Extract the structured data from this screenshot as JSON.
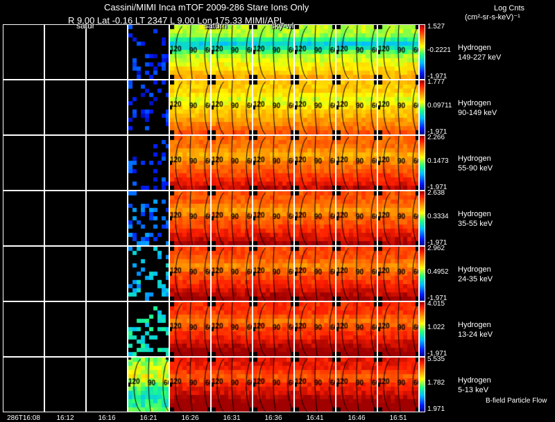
{
  "header": {
    "title": "Cassini/MIMI Inca mTOF  2009-286   Stare   Ions Only",
    "position_line": "R        9.00 Lat -0.16 LT 2347 L        9.00 Lon       175.33  MIMI/APL",
    "units_line1": "Log Cnts",
    "units_line2": "(cm²-sr-s-keV)⁻¹"
  },
  "overlay_labels": [
    "satur",
    "saturn",
    "sky-wl"
  ],
  "rows": [
    {
      "species": "Hydrogen",
      "energy": "149-227 keV",
      "cbar_max": "1.527",
      "cbar_mid": "-0.2221",
      "cbar_min": "-1.971",
      "sparse_level": 0.12,
      "image_level": 0.5
    },
    {
      "species": "Hydrogen",
      "energy": "90-149 keV",
      "cbar_max": "1.777",
      "cbar_mid": "0.09711",
      "cbar_min": "-1.971",
      "sparse_level": 0.12,
      "image_level": 0.62
    },
    {
      "species": "Hydrogen",
      "energy": "55-90 keV",
      "cbar_max": "2.266",
      "cbar_mid": "0.1473",
      "cbar_min": "-1.971",
      "sparse_level": 0.15,
      "image_level": 0.75
    },
    {
      "species": "Hydrogen",
      "energy": "35-55 keV",
      "cbar_max": "2.638",
      "cbar_mid": "0.3334",
      "cbar_min": "-1.971",
      "sparse_level": 0.2,
      "image_level": 0.78
    },
    {
      "species": "Hydrogen",
      "energy": "24-35 keV",
      "cbar_max": "2.962",
      "cbar_mid": "0.4952",
      "cbar_min": "-1.971",
      "sparse_level": 0.3,
      "image_level": 0.8
    },
    {
      "species": "Hydrogen",
      "energy": "13-24 keV",
      "cbar_max": "4.015",
      "cbar_mid": "1.022",
      "cbar_min": "-1.971",
      "sparse_level": 0.38,
      "image_level": 0.83
    },
    {
      "species": "Hydrogen",
      "energy": "5-13 keV",
      "cbar_max": "5.535",
      "cbar_mid": "1.782",
      "cbar_min": "1.971",
      "sparse_level": 0.5,
      "image_level": 0.87
    }
  ],
  "contour_labels": [
    "120",
    "90",
    "60"
  ],
  "time_labels": [
    "286T16:08",
    "16:12",
    "16:16",
    "16:21",
    "16:26",
    "16:31",
    "16:36",
    "16:41",
    "16:46",
    "16:51"
  ],
  "footer_note": "B-field Particle Flow"
}
